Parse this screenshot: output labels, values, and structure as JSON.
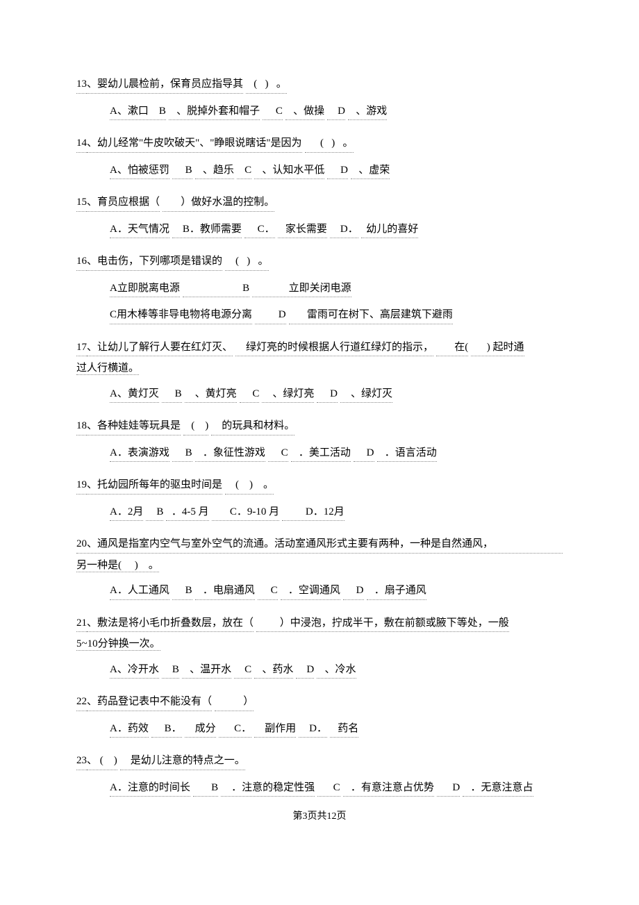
{
  "questions": [
    {
      "num": "13",
      "stem_parts": [
        "、婴幼儿晨检前，保育员应指导其",
        "   (   )   。"
      ],
      "options_rows": [
        [
          "A、漱口    B",
          "   、脱掉外套和帽子",
          "     C",
          "   、做操",
          "    D",
          "   、游戏"
        ]
      ]
    },
    {
      "num": "14",
      "stem_parts": [
        "、幼儿经常\"牛皮吹破天\"、\"睁眼说瞎话\"是因为",
        "      (   )   。"
      ],
      "options_rows": [
        [
          "A、怕被惩罚",
          "     B",
          "   、趋乐",
          "   C",
          "   、认知水平低",
          "     D",
          "   、虚荣"
        ]
      ]
    },
    {
      "num": "15",
      "stem_parts": [
        "、育员应根据（",
        "       ）做好水温的控制。"
      ],
      "options_rows": [
        [
          "A．天气情况",
          "    B．教师需要",
          "     C．",
          "   家长需要",
          "    D．",
          "  幼儿的喜好"
        ]
      ]
    },
    {
      "num": "16",
      "stem_parts": [
        "、电击伤，下列哪项是错误的",
        "    (   )   。"
      ],
      "options_rows": [
        [
          "A立即脱离电源",
          "                       B",
          "              立即关闭电源"
        ],
        [
          "C用木棒等非导电物将电源分离",
          "         D",
          "       雷雨可在树下、高层建筑下避雨"
        ]
      ]
    },
    {
      "num": "17",
      "stem_parts": [
        "、让幼儿了解行人要在红灯灭、",
        "    绿灯亮的时候根据人行道红绿灯的指示，",
        "       在(",
        "      ) 起时通"
      ],
      "stem_line2": "过人行横道。",
      "options_rows": [
        [
          "A、黄灯灭",
          "     B",
          "    、黄灯亮",
          "     C",
          "    、绿灯亮",
          "     D",
          "    、绿灯灭"
        ]
      ]
    },
    {
      "num": "18",
      "stem_parts": [
        "、各种娃娃等玩具是",
        "   (    )",
        "    的玩具和材料。"
      ],
      "options_rows": [
        [
          "A．表演游戏",
          "     B",
          "   ．象征性游戏",
          "     C",
          "   ．美工活动",
          "     D",
          "   ．语言活动"
        ]
      ]
    },
    {
      "num": "19",
      "stem_parts": [
        "、托幼园所每年的驱虫时间是",
        "    (    )    。"
      ],
      "options_rows": [
        [
          "A．2月",
          "    B",
          "  ．4-5 月",
          "       C．9-10 月",
          "         D．12月"
        ]
      ]
    },
    {
      "num": "20",
      "stem_parts": [
        "、通风是指室内空气与室外空气的流通。活动室通风形式主要有两种，一种是自然通风，"
      ],
      "stem_line2": "另一种是(     )    。",
      "options_rows": [
        [
          "A．人工通风",
          "     B",
          "   ．电扇通风",
          "     C",
          "   ．空调通风",
          "     D",
          "   ．扇子通风"
        ]
      ]
    },
    {
      "num": "21",
      "stem_parts": [
        "、敷法是将小毛巾折叠数层，放在（",
        "         ）中浸泡，拧成半干，敷在前额或腋下等处，一般"
      ],
      "stem_line2": "5~10分钟换一次。",
      "options_rows": [
        [
          "A、冷开水",
          "    B",
          "   、温开水",
          "    C",
          "   、药水",
          "    D",
          "   、冷水"
        ]
      ]
    },
    {
      "num": "22",
      "stem_parts": [
        "、药品登记表中不能没有（",
        "           ）"
      ],
      "options_rows": [
        [
          "A．药效",
          "     B．",
          "    成分",
          "      C．",
          "    副作用",
          "    D．",
          "   药名"
        ]
      ]
    },
    {
      "num": "23",
      "stem_parts": [
        "、 (    )",
        "    是幼儿注意的特点之一。"
      ],
      "options_rows": [
        [
          "A．注意的时间长",
          "       B",
          "    ．注意的稳定性强",
          "      C",
          "   ．有意注意占优势",
          "      D",
          "   ．无意注意占"
        ]
      ]
    }
  ],
  "footer": {
    "prefix": "第",
    "current": "3",
    "mid": "页共",
    "total": "12",
    "suffix": "页"
  }
}
